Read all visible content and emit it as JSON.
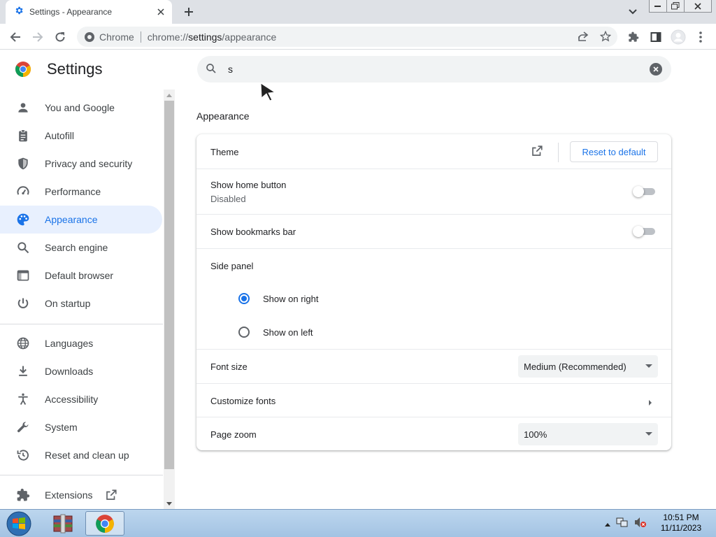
{
  "browser": {
    "tab_title": "Settings - Appearance",
    "omnibox_site": "Chrome",
    "omnibox_url_prefix": "chrome://",
    "omnibox_url_path": "settings",
    "omnibox_url_suffix": "/appearance"
  },
  "header": {
    "app_title": "Settings",
    "search_value": "s"
  },
  "sidebar": {
    "items": [
      {
        "label": "You and Google",
        "icon": "person-icon"
      },
      {
        "label": "Autofill",
        "icon": "clipboard-icon"
      },
      {
        "label": "Privacy and security",
        "icon": "shield-icon"
      },
      {
        "label": "Performance",
        "icon": "speedometer-icon"
      },
      {
        "label": "Appearance",
        "icon": "palette-icon",
        "active": true
      },
      {
        "label": "Search engine",
        "icon": "search-icon"
      },
      {
        "label": "Default browser",
        "icon": "browser-window-icon"
      },
      {
        "label": "On startup",
        "icon": "power-icon"
      },
      {
        "label": "Languages",
        "icon": "globe-icon"
      },
      {
        "label": "Downloads",
        "icon": "download-icon"
      },
      {
        "label": "Accessibility",
        "icon": "accessibility-icon"
      },
      {
        "label": "System",
        "icon": "wrench-icon"
      },
      {
        "label": "Reset and clean up",
        "icon": "history-icon"
      },
      {
        "label": "Extensions",
        "icon": "puzzle-icon"
      }
    ]
  },
  "appearance": {
    "section_title": "Appearance",
    "theme_label": "Theme",
    "reset_label": "Reset to default",
    "home_button_label": "Show home button",
    "home_button_sub": "Disabled",
    "bookmarks_bar_label": "Show bookmarks bar",
    "side_panel_label": "Side panel",
    "side_panel_options": [
      "Show on right",
      "Show on left"
    ],
    "side_panel_selected": "Show on right",
    "font_size_label": "Font size",
    "font_size_value": "Medium (Recommended)",
    "customize_fonts_label": "Customize fonts",
    "page_zoom_label": "Page zoom",
    "page_zoom_value": "100%"
  },
  "taskbar": {
    "time": "10:51 PM",
    "date": "11/11/2023"
  },
  "colors": {
    "accent": "#1a73e8",
    "active_nav_bg": "#e8f0fe"
  }
}
